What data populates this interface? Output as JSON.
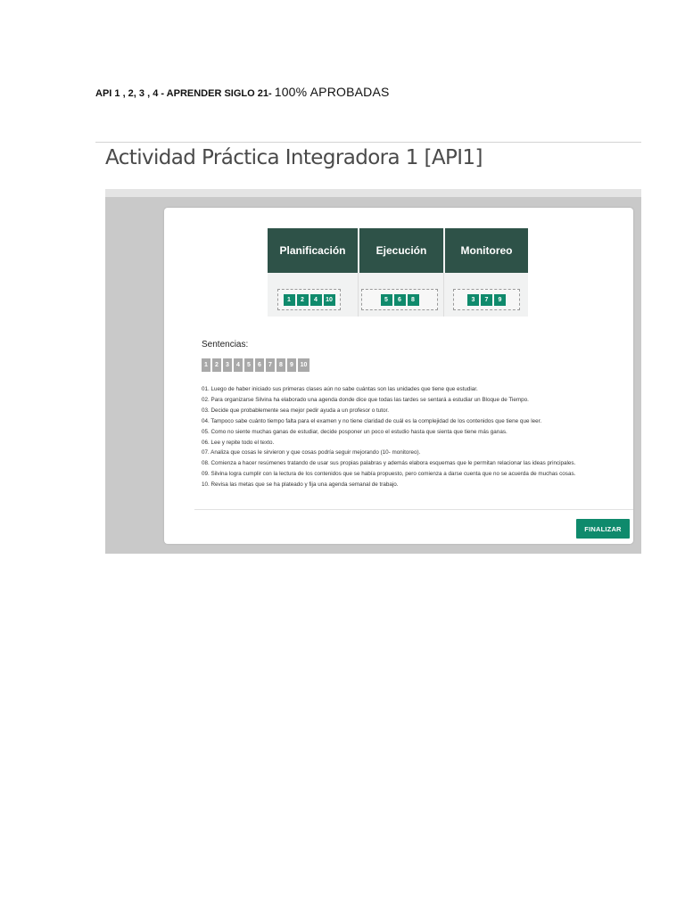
{
  "document": {
    "heading_prefix": "API  1 , 2, 3 , 4  - APRENDER SIGLO 21- ",
    "heading_suffix": "100% APROBADAS"
  },
  "activity": {
    "title": "Actividad Práctica Integradora 1 [API1]"
  },
  "categories": [
    {
      "label": "Planificación",
      "chips": [
        "1",
        "2",
        "4",
        "10"
      ]
    },
    {
      "label": "Ejecución",
      "chips": [
        "5",
        "6",
        "8"
      ]
    },
    {
      "label": "Monitoreo",
      "chips": [
        "3",
        "7",
        "9"
      ]
    }
  ],
  "sentences": {
    "title": "Sentencias:",
    "number_chips": [
      "1",
      "2",
      "3",
      "4",
      "5",
      "6",
      "7",
      "8",
      "9",
      "10"
    ],
    "items": [
      "01.  Luego de haber iniciado sus primeras clases aún no sabe cuántas son las unidades que tiene que estudiar.",
      "02. Para organizarse Silvina ha elaborado una agenda donde dice que todas las tardes se sentará a estudiar un Bloque de Tiempo.",
      "03. Decide que probablemente sea mejor pedir ayuda a un profesor o tutor.",
      "04. Tampoco sabe cuánto tiempo falta para el examen y no tiene claridad de cuál es la complejidad de los contenidos que tiene que leer.",
      "05. Como no siente muchas ganas de estudiar, decide posponer un poco el estudio hasta que sienta que tiene más ganas.",
      "06. Lee y repite todo el texto.",
      "07. Analiza que cosas le sirvieron y que cosas podría seguir mejorando (10- monitoreo).",
      "08. Comienza a hacer resúmenes tratando de usar sus propias palabras y además elabora esquemas que le permitan relacionar las ideas principales.",
      "09. Silvina logra cumplir con la lectura de los contenidos que se había propuesto, pero comienza a darse cuenta que no se acuerda de muchas cosas.",
      "10. Revisa las metas que se ha plateado y fija una agenda semanal de trabajo."
    ]
  },
  "actions": {
    "finalize_label": "FINALIZAR"
  },
  "colors": {
    "header_green": "#2e5248",
    "chip_green": "#0f8a6c",
    "chip_gray": "#a9a9a9"
  }
}
